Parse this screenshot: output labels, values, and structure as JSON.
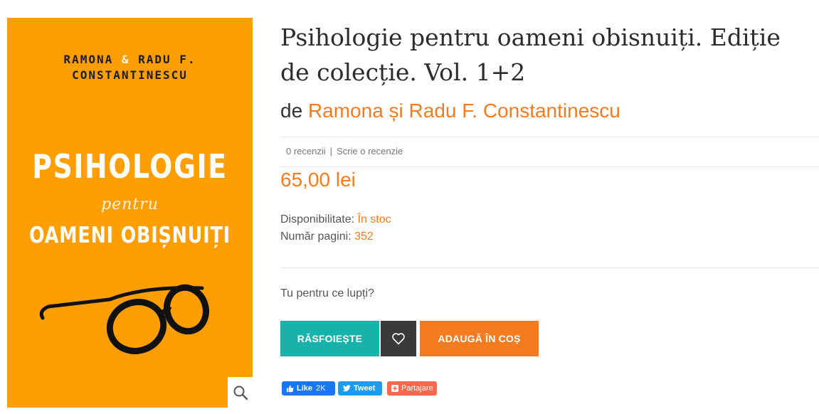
{
  "cover": {
    "author_line1_a": "RAMONA",
    "author_amp": "&",
    "author_line1_b": "RADU F.",
    "author_line2": "CONSTANTINESCU",
    "title_main": "PSIHOLOGIE",
    "title_mid": "pentru",
    "title_bottom": "OAMENI OBIȘNUIȚI",
    "zoom_icon": "magnifier-icon"
  },
  "product": {
    "title": "Psihologie pentru oameni obisnuiți. Ediție de colecție. Vol. 1+2",
    "by_label": "de",
    "author": "Ramona și Radu F. Constantinescu",
    "reviews_count": "0 recenzii",
    "reviews_sep": "|",
    "write_review": "Scrie o recenzie",
    "price": "65,00 lei",
    "availability_label": "Disponibilitate:",
    "availability_value": "În stoc",
    "pages_label": "Număr pagini:",
    "pages_value": "352",
    "question": "Tu pentru ce lupți?"
  },
  "actions": {
    "browse_label": "RĂSFOIEȘTE",
    "wishlist_icon": "heart-icon",
    "add_to_cart_label": "ADAUGĂ ÎN COȘ"
  },
  "share": {
    "fb_label": "Like",
    "fb_count": "2K",
    "tweet_label": "Tweet",
    "share_label": "Partajare"
  },
  "colors": {
    "accent": "#f47b20",
    "cover": "#ff9e00",
    "browse": "#17b3aa",
    "wishlist": "#3a3a3a"
  }
}
